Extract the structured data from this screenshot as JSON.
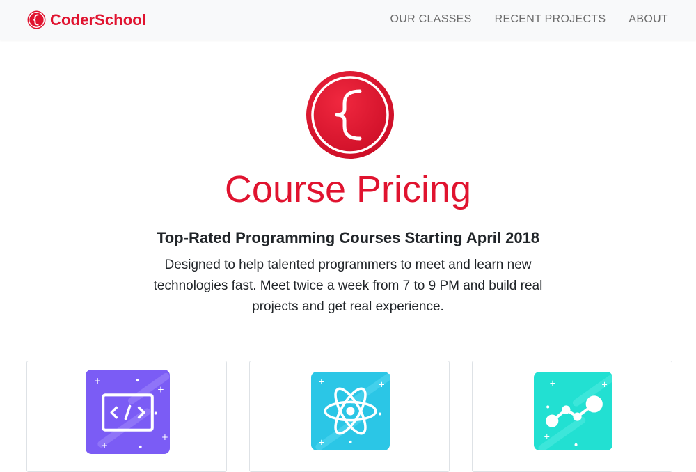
{
  "brand": {
    "name": "CoderSchool",
    "accent_color": "#e0132f"
  },
  "nav": {
    "items": [
      {
        "label": "OUR CLASSES"
      },
      {
        "label": "RECENT PROJECTS"
      },
      {
        "label": "ABOUT"
      }
    ]
  },
  "hero": {
    "logo_icon": "curly-brace-logo-icon",
    "title": "Course Pricing",
    "subtitle": "Top-Rated Programming Courses Starting April 2018",
    "description": "Designed to help talented programmers to meet and learn new technologies fast. Meet twice a week from 7 to 9 PM and build real projects and get real experience."
  },
  "cards": [
    {
      "icon": "code-window-icon",
      "color": "#7b5cf5"
    },
    {
      "icon": "react-atom-icon",
      "color": "#2bc6e6"
    },
    {
      "icon": "data-graph-icon",
      "color": "#22e0d2"
    }
  ]
}
